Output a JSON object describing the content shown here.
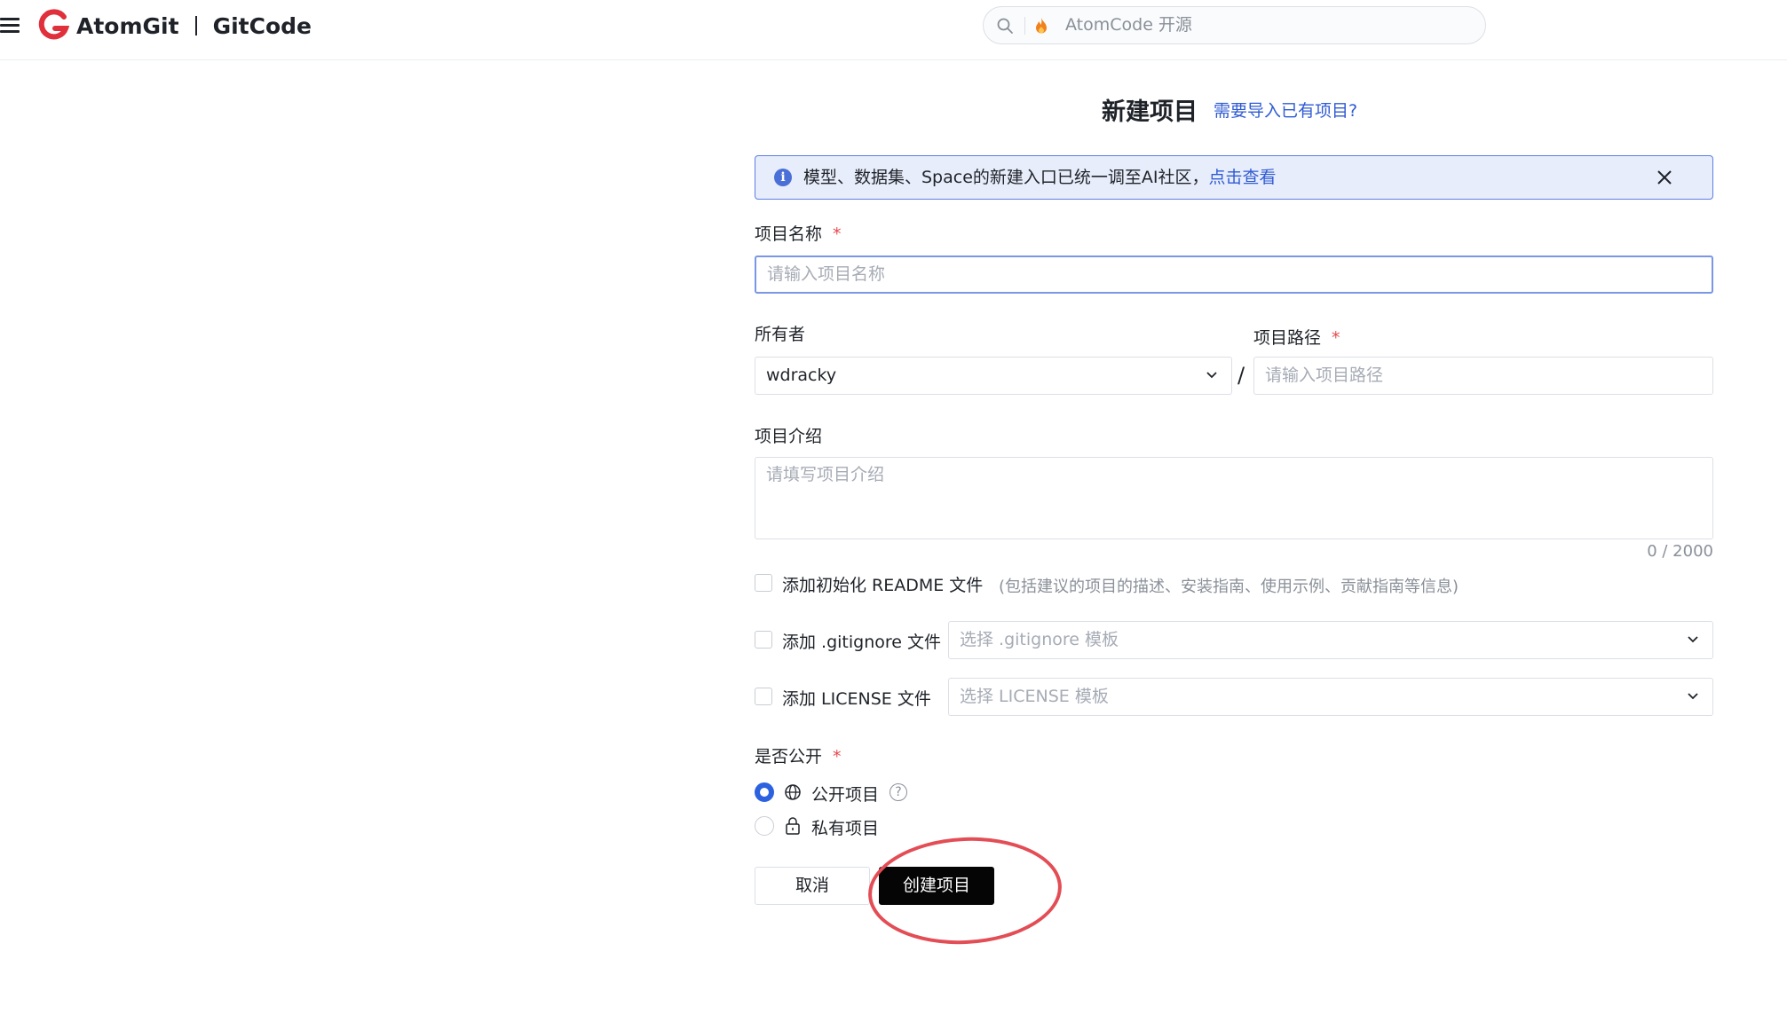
{
  "header": {
    "brand_primary": "AtomGit",
    "brand_secondary": "GitCode",
    "search_placeholder": "AtomCode 开源"
  },
  "form": {
    "title": "新建项目",
    "import_link": "需要导入已有项目?",
    "notice": {
      "text": "模型、数据集、Space的新建入口已统一调至AI社区，",
      "link": "点击查看"
    },
    "name": {
      "label": "项目名称",
      "required_mark": "*",
      "placeholder": "请输入项目名称"
    },
    "owner": {
      "label": "所有者",
      "value": "wdracky"
    },
    "path_separator": "/",
    "path": {
      "label": "项目路径",
      "required_mark": "*",
      "placeholder": "请输入项目路径"
    },
    "description": {
      "label": "项目介绍",
      "placeholder": "请填写项目介绍",
      "counter": "0 / 2000"
    },
    "readme": {
      "label": "添加初始化 README 文件",
      "hint": "(包括建议的项目的描述、安装指南、使用示例、贡献指南等信息)",
      "checked": false
    },
    "gitignore": {
      "label": "添加 .gitignore 文件",
      "select_placeholder": "选择 .gitignore 模板",
      "checked": false
    },
    "license": {
      "label": "添加 LICENSE 文件",
      "select_placeholder": "选择 LICENSE 模板",
      "checked": false
    },
    "visibility": {
      "label": "是否公开",
      "required_mark": "*",
      "options": [
        {
          "label": "公开项目",
          "selected": true,
          "icon": "globe-icon"
        },
        {
          "label": "私有项目",
          "selected": false,
          "icon": "lock-icon"
        }
      ]
    },
    "buttons": {
      "cancel": "取消",
      "create": "创建项目"
    }
  },
  "colors": {
    "accent": "#2c62e0",
    "link": "#2f5bd3",
    "notice_bg": "#e8edfb",
    "primary_button": "#050505",
    "annotation_circle": "#e34d55",
    "logo": "#e0303b"
  }
}
